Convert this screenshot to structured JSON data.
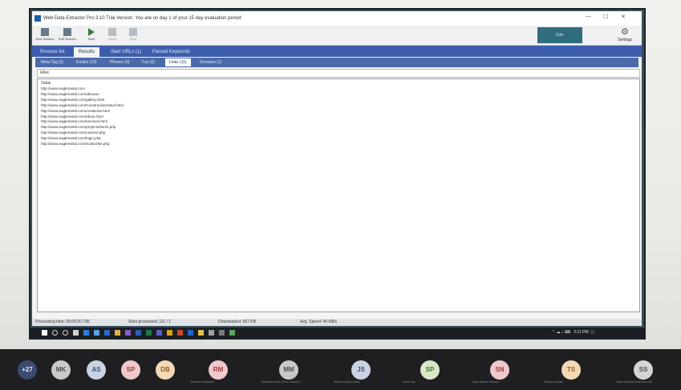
{
  "window": {
    "title": "Web Data Extractor Pro 3.10 Trial Version. You are on day 1 of your 15 day evaluation period",
    "minimize": "—",
    "maximize": "☐",
    "close": "✕"
  },
  "toolbar": {
    "buttons": [
      {
        "label": "New Session",
        "icon": "new-session-icon"
      },
      {
        "label": "Edit Session",
        "icon": "edit-session-icon"
      },
      {
        "label": "Start",
        "icon": "play-icon"
      },
      {
        "label": "Pause",
        "icon": "pause-icon"
      },
      {
        "label": "Stop",
        "icon": "stop-icon"
      }
    ],
    "banner": "Ctrl+",
    "settings_label": "Settings",
    "settings_icon": "gear-icon"
  },
  "main_tabs": [
    "Process list",
    "Results",
    "Start URLs (1)",
    "Parsed Keywords"
  ],
  "main_tabs_active": 1,
  "result_tabs": [
    "Meta Tag (2)",
    "Emails (10)",
    "Phones (0)",
    "Fax (0)",
    "Links (11)",
    "Domains (1)"
  ],
  "result_tabs_active": 4,
  "filter_label": "Filter",
  "column_header": "Value",
  "links": [
    "http://www.eaglemetal.com",
    "http://www.eaglemetal.com/aboutus",
    "http://www.eaglemetal.com/gallery.html",
    "http://www.eaglemetal.com/Construction/steel.html",
    "http://www.eaglemetal.com/contactus.html",
    "http://www.eaglemetal.com/about.html",
    "http://www.eaglemetal.com/services.html",
    "http://www.eaglemetal.com/projects/items.php",
    "http://www.eaglemetal.com/careers.php",
    "http://www.eaglemetal.com/login.php",
    "http://www.eaglemetal.com/Subscribe.php"
  ],
  "status": {
    "processing_time": "Processing time: 00:00:20.795",
    "sites_processed": "Sites processed: 111 / 1",
    "downloaded": "Downloaded: 567 KB",
    "avg_speed": "Avg. Speed: 40 KB/s"
  },
  "taskbar": {
    "time": "2:11 PM",
    "icons": [
      "windows-icon",
      "search-icon",
      "cortana-icon",
      "taskview-icon",
      "edge-icon",
      "store-icon",
      "mail-icon",
      "files-icon",
      "photos-icon",
      "word-icon",
      "excel-icon",
      "teams-icon",
      "chrome-icon",
      "powerpoint-icon",
      "outlook-icon",
      "explorer-icon",
      "settings-icon",
      "terminal-icon",
      "app-icon"
    ]
  },
  "participants": [
    {
      "initials": "+27",
      "name": "",
      "color": "#3b4a70",
      "text": "#e8ecf5"
    },
    {
      "initials": "MK",
      "name": "",
      "color": "#c9c9cd",
      "text": "#4d4d52"
    },
    {
      "initials": "AS",
      "name": "",
      "color": "#cbd3e2",
      "text": "#3f4f73"
    },
    {
      "initials": "SP",
      "name": "",
      "color": "#f1c9cb",
      "text": "#9b3a40"
    },
    {
      "initials": "DB",
      "name": "",
      "color": "#f4d9b5",
      "text": "#9a5a20"
    },
    {
      "initials": "RM",
      "name": "Roshan Mohanani",
      "color": "#f1c9cb",
      "text": "#9b3a40"
    },
    {
      "initials": "MM",
      "name": "Mahrukh Mobin (Fida Hussain)",
      "color": "#c9c9cd",
      "text": "#4d4d52"
    },
    {
      "initials": "JS",
      "name": "Jivesh Singh (Guest)",
      "color": "#cbd3e2",
      "text": "#3f4f73"
    },
    {
      "initials": "SP",
      "name": "Saira Palu",
      "color": "#d8e8c8",
      "text": "#4a6a2f"
    },
    {
      "initials": "SN",
      "name": "Syed Nabeel Hussain",
      "color": "#f1c9cb",
      "text": "#9b3a40"
    },
    {
      "initials": "TS",
      "name": "Tahmina Shakir",
      "color": "#f4d9b5",
      "text": "#9a5a20"
    },
    {
      "initials": "SS",
      "name": "Sadia Sadiq (Guest Account)",
      "color": "#d5d5d9",
      "text": "#4d4d52"
    }
  ]
}
